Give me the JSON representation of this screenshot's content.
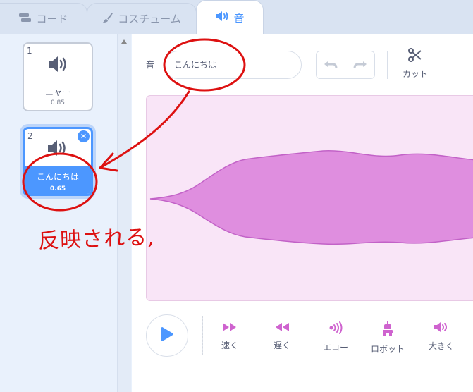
{
  "tabs": {
    "code_label": "コード",
    "costume_label": "コスチューム",
    "sound_label": "音"
  },
  "sounds": [
    {
      "number": "1",
      "name": "ニャー",
      "duration": "0.85"
    },
    {
      "number": "2",
      "name": "こんにちは",
      "duration": "0.65"
    }
  ],
  "editor": {
    "field_label": "音",
    "sound_name_value": "こんにちは",
    "cut_label": "カット"
  },
  "effects": {
    "faster": "速く",
    "slower": "遅く",
    "echo": "エコー",
    "robot": "ロボット",
    "louder": "大きく"
  },
  "annotation": {
    "text": "反映される,"
  },
  "colors": {
    "accent": "#4c97ff",
    "waveform_fill": "#df8edf",
    "effect_icon": "#cf63cf",
    "annotation": "#dd1111"
  }
}
